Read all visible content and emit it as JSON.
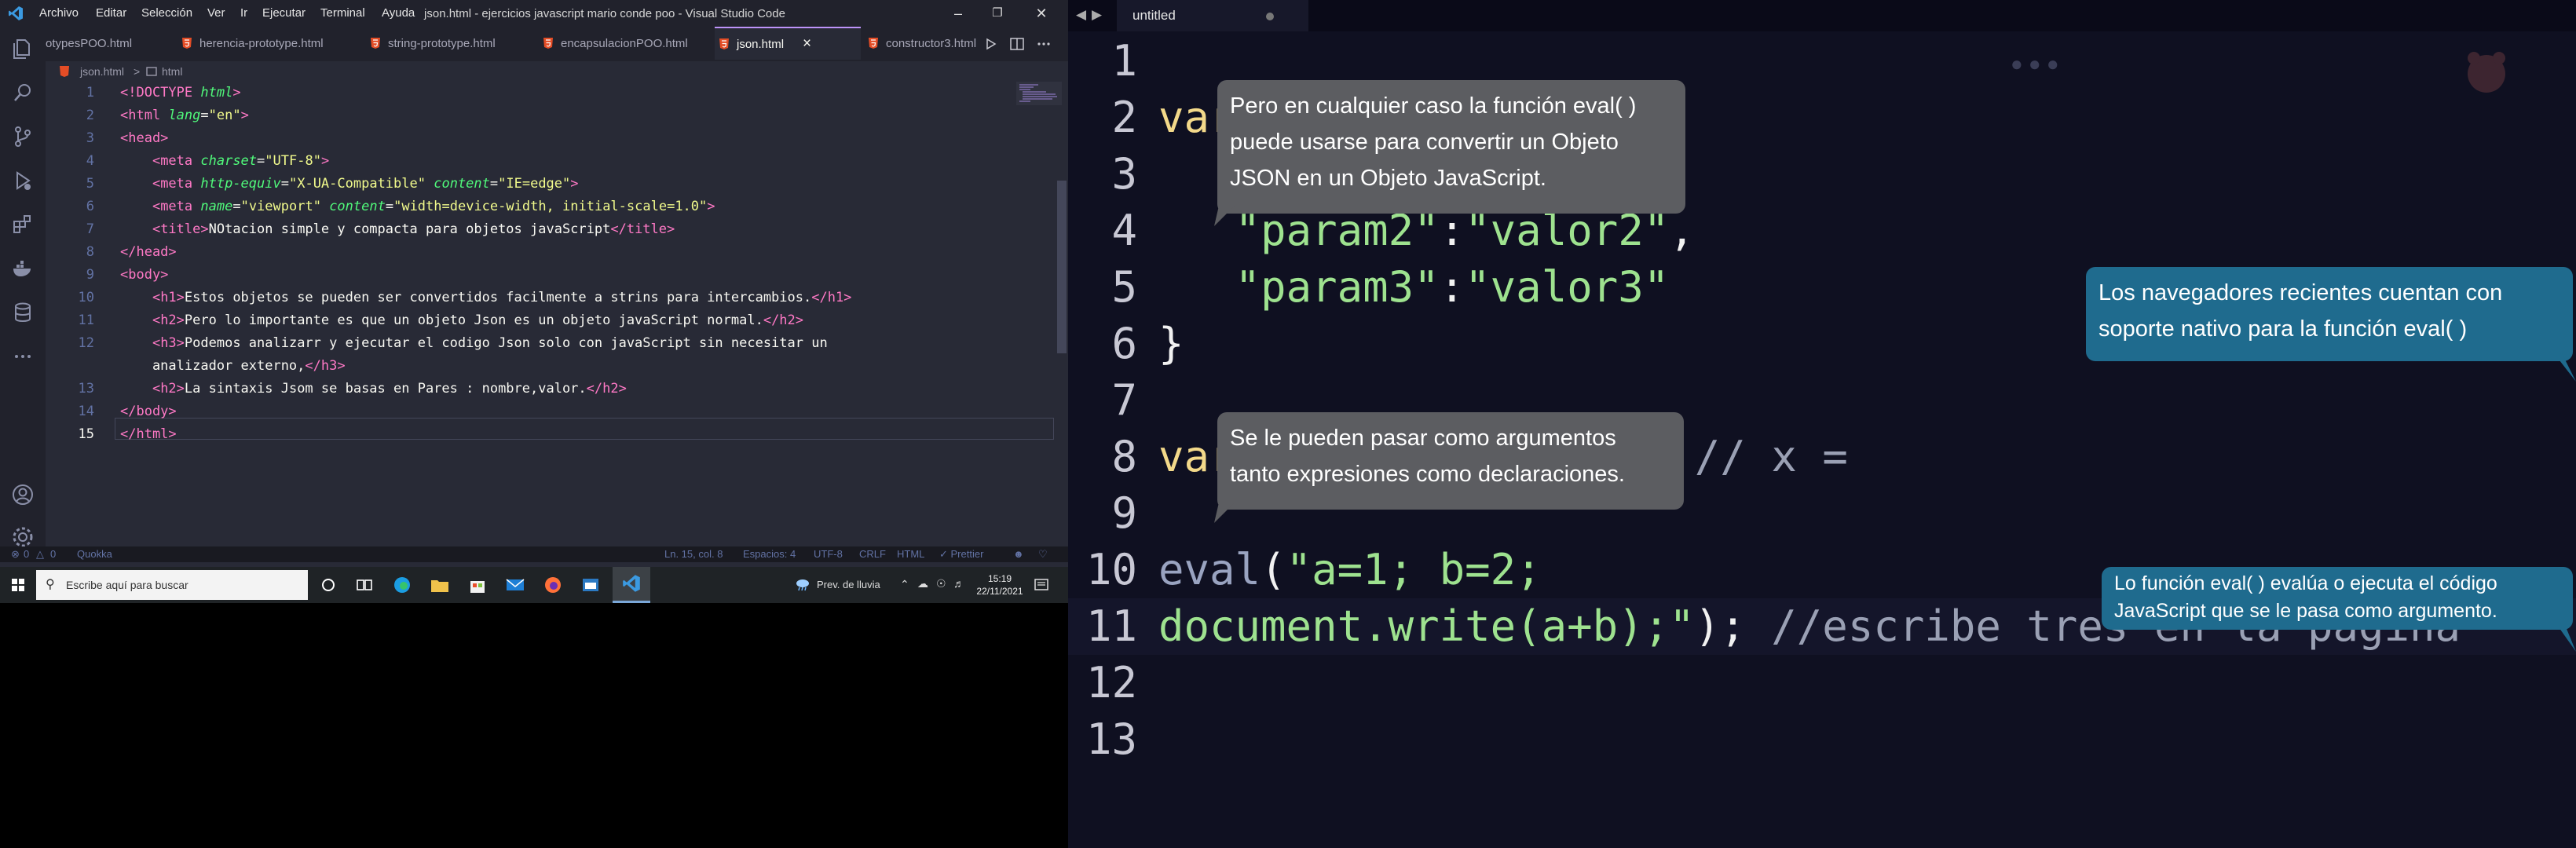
{
  "vscode": {
    "title": "json.html - ejercicios javascript mario conde poo - Visual Studio Code",
    "menu": [
      "Archivo",
      "Editar",
      "Selección",
      "Ver",
      "Ir",
      "Ejecutar",
      "Terminal",
      "Ayuda"
    ],
    "tabs": [
      {
        "label": "otypesPOO.html"
      },
      {
        "label": "herencia-prototype.html"
      },
      {
        "label": "string-prototype.html"
      },
      {
        "label": "encapsulacionPOO.html"
      },
      {
        "label": "json.html",
        "close": "×"
      },
      {
        "label": "constructor3.html"
      }
    ],
    "breadcrumb": {
      "file": "json.html",
      "sep": ">",
      "node": "html"
    },
    "line_numbers": [
      "1",
      "2",
      "3",
      "4",
      "5",
      "6",
      "7",
      "8",
      "9",
      "10",
      "11",
      "12",
      "13",
      "14",
      "15"
    ],
    "current_line": "15",
    "status": {
      "errors": "0",
      "warnings": "0",
      "quokka": "Quokka",
      "position": "Ln. 15, col. 8",
      "spaces": "Espacios: 4",
      "encoding": "UTF-8",
      "eol": "CRLF",
      "language": "HTML",
      "prettier": "✓ Prettier"
    }
  },
  "taskbar": {
    "search_placeholder": "Escribe aquí para buscar",
    "weather": "Prev. de lluvia",
    "time": "15:19",
    "date": "22/11/2021"
  },
  "sublime": {
    "tab_label": "untitled",
    "line_numbers": [
      "1",
      "2",
      "3",
      "4",
      "5",
      "6",
      "7",
      "8",
      "9",
      "10",
      "11",
      "12",
      "13"
    ]
  },
  "bubbles": [
    {
      "text": "Pero en cualquier caso la función eval( ) puede usarse para convertir un Objeto JSON en un Objeto JavaScript."
    },
    {
      "text": "Los navegadores recientes cuentan con soporte nativo para la función eval( )"
    },
    {
      "text": "Se le pueden pasar como argumentos tanto expresiones como declaraciones."
    },
    {
      "text": "Lo función eval( ) evalúa o ejecuta el código JavaScript que se le pasa como argumento."
    }
  ],
  "colors": {
    "editor_bg": "#282a36",
    "accent": "#bd93f9",
    "tag": "#ff79c6",
    "attr": "#50fa7b",
    "string": "#f1fa8c",
    "bubble_gray": "#5c5d61",
    "bubble_teal": "#1f6b8e"
  }
}
